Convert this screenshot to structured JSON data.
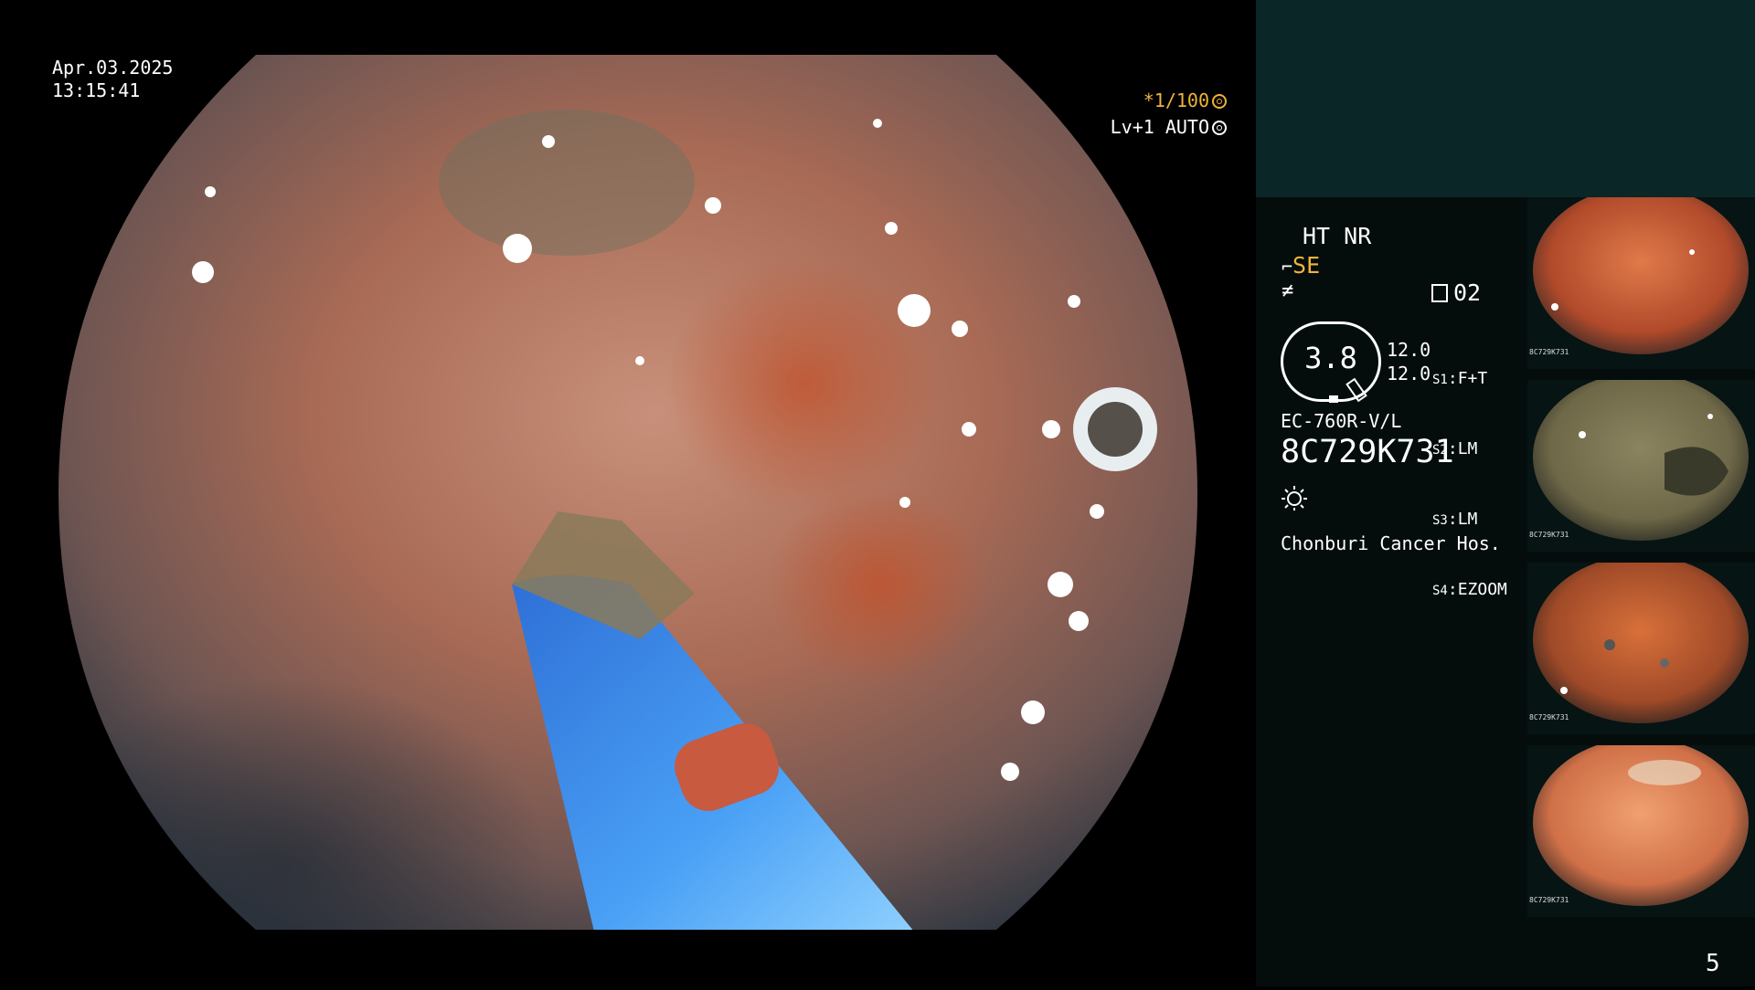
{
  "overlay": {
    "date": "Apr.03.2025",
    "time": "13:15:41",
    "shutter": "*1/100",
    "iris": "Lv+1 AUTO"
  },
  "settings": {
    "ht_nr": "HT NR",
    "se": "SE",
    "memory": "02",
    "zoom": "3.8",
    "level_1": "12.0",
    "level_2": "12.0",
    "scope_switches": [
      {
        "key": "S1",
        "value": "F+T"
      },
      {
        "key": "S2",
        "value": "LM"
      },
      {
        "key": "S3",
        "value": "LM"
      },
      {
        "key": "S4",
        "value": "EZOOM"
      }
    ],
    "model": "EC-760R-V/L",
    "serial": "8C729K731",
    "hospital": "Chonburi Cancer Hos."
  },
  "page_number": "5",
  "thumbnails": [
    {
      "serial": "8C729K731",
      "tone": "orange"
    },
    {
      "serial": "8C729K731",
      "tone": "olive"
    },
    {
      "serial": "8C729K731",
      "tone": "orange-dark"
    },
    {
      "serial": "8C729K731",
      "tone": "orange-light"
    }
  ],
  "colors": {
    "accent_orange": "#f0b43a",
    "side_top": "#0b2626",
    "side_panel": "#040d0c"
  }
}
